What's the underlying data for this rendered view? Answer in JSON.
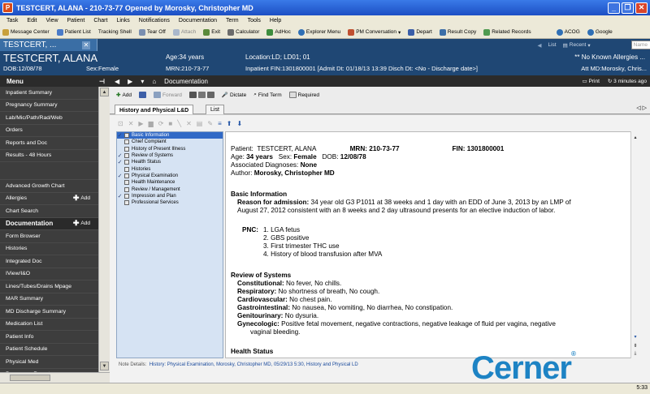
{
  "window": {
    "title": "TESTCERT, ALANA - 210-73-77 Opened by Morosky, Christopher MD",
    "app_letter": "P"
  },
  "menubar": [
    "Task",
    "Edit",
    "View",
    "Patient",
    "Chart",
    "Links",
    "Notifications",
    "Documentation",
    "Term",
    "Tools",
    "Help"
  ],
  "toolbar": [
    "Message Center",
    "Patient List",
    "Tracking Shell",
    "Tear Off",
    "Attach",
    "Exit",
    "Calculator",
    "AdHoc",
    "Explorer Menu",
    "PM Conversation",
    "Depart",
    "Result Copy",
    "Related Records",
    "ACOG",
    "Google"
  ],
  "patient": {
    "tab_label": "TESTCERT, ...",
    "list_label": "List",
    "recent_label": "Recent",
    "name_placeholder": "Name",
    "name": "TESTCERT, ALANA",
    "dob": "DOB:12/08/78",
    "sex": "Sex:Female",
    "age": "Age:34 years",
    "mrn": "MRN:210-73-77",
    "location": "Location:LD; LD01; 01",
    "fin": "Inpatient FIN:1301800001 [Admit Dt: 01/18/13 13:39 Disch Dt: <No - Discharge date>]",
    "allergies": "** No Known Allergies ...",
    "attending": "Att MD:Morosky, Chris..."
  },
  "menu": {
    "title": "Menu",
    "items": [
      "Inpatient Summary",
      "Pregnancy Summary",
      "Lab/Mic/Path/Rad/Web",
      "Orders",
      "Reports and Doc",
      "Results - 48 Hours",
      "",
      "Advanced Growth Chart",
      "Allergies",
      "Chart Search",
      "Documentation",
      "Form Browser",
      "Histories",
      "Integrated Doc",
      "IView/I&O",
      "Lines/Tubes/Drains Mpage",
      "MAR Summary",
      "MD Discharge Summary",
      "Medication List",
      "Patient Info",
      "Patient Schedule",
      "Physical Med",
      "Pregnancy Report"
    ],
    "add_label": "Add"
  },
  "nav": {
    "title": "Documentation",
    "print_label": "Print",
    "refresh_label": "3 minutes ago"
  },
  "doctoolbar": [
    "Add",
    "Forward",
    "Dictate",
    "Find Term",
    "Required"
  ],
  "tabs": [
    "History and Physical L&D",
    "List"
  ],
  "tree": {
    "items": [
      {
        "label": "Basic Information",
        "checked": true,
        "selected": true
      },
      {
        "label": "Chief Complaint",
        "checked": false,
        "selected": false
      },
      {
        "label": "History of Present Illness",
        "checked": false,
        "selected": false
      },
      {
        "label": "Review of Systems",
        "checked": true,
        "selected": false
      },
      {
        "label": "Health Status",
        "checked": true,
        "selected": false
      },
      {
        "label": "Histories",
        "checked": false,
        "selected": false
      },
      {
        "label": "Physical Examination",
        "checked": true,
        "selected": false
      },
      {
        "label": "Health Maintenance",
        "checked": false,
        "selected": false
      },
      {
        "label": "Review / Management",
        "checked": false,
        "selected": false
      },
      {
        "label": "Impression and Plan",
        "checked": true,
        "selected": false
      },
      {
        "label": "Professional Services",
        "checked": false,
        "selected": false
      }
    ]
  },
  "note": {
    "patient_label": "Patient:",
    "patient": "TESTCERT, ALANA",
    "mrn_label": "MRN:",
    "mrn": "210-73-77",
    "fin_label": "FIN:",
    "fin": "1301800001",
    "age_label": "Age:",
    "age": "34 years",
    "sex_label": "Sex:",
    "sex": "Female",
    "dob_label": "DOB:",
    "dob": "12/08/78",
    "diag_label": "Associated Diagnoses:",
    "diag": "None",
    "author_label": "Author:",
    "author": "Morosky, Christopher MD",
    "basic_heading": "Basic Information",
    "reason_label": "Reason for admission:",
    "reason_line1": "34 year old G3 P1011 at 38 weeks and 1 day with an EDD of June 3, 2013 by an LMP of",
    "reason_line2": "August 27, 2012 consistent with an 8 weeks and 2 day ultrasound presents for an elective induction of labor.",
    "pnc_label": "PNC:",
    "pnc_items": [
      "1. LGA fetus",
      "2. GBS positive",
      "3. First trimester THC use",
      "4. History of blood transfusion after MVA"
    ],
    "ros_heading": "Review of Systems",
    "ros": [
      {
        "label": "Constitutional:",
        "text": "No fever, No chills."
      },
      {
        "label": "Respiratory:",
        "text": "No shortness of breath, No cough."
      },
      {
        "label": "Cardiovascular:",
        "text": "No chest pain."
      },
      {
        "label": "Gastrointestinal:",
        "text": "No nausea, No vomiting, No diarrhea, No constipation."
      },
      {
        "label": "Genitourinary:",
        "text": "No dysuria."
      },
      {
        "label": "Gynecologic:",
        "text": "Positive fetal movement, negative contractions, negative leakage of fluid per vagina, negative"
      }
    ],
    "gyn_line2": "vaginal bleeding.",
    "next_heading": "Health Status"
  },
  "note_details": {
    "label": "Note Details:",
    "text": "History: Physical Examination, Morosky, Christopher MD, 05/29/13 5:30, History and Physical LD"
  },
  "logo": "Cerner",
  "status_time": "5:33"
}
